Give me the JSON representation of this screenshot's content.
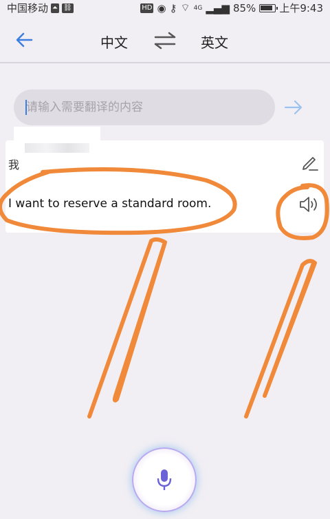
{
  "status_bar": {
    "carrier": "中国移动",
    "hd": "HD",
    "network": "4G",
    "battery": "85%",
    "time": "上午9:43"
  },
  "header": {
    "source_lang": "中文",
    "target_lang": "英文",
    "back_icon": "back-arrow-icon",
    "swap_icon": "swap-icon"
  },
  "input": {
    "placeholder": "请输入需要翻译的内容",
    "value": ""
  },
  "result": {
    "source_text": "我",
    "source_end": "。",
    "translation": "I want to reserve a standard room.",
    "edit_icon": "edit-icon",
    "speaker_icon": "speaker-icon"
  },
  "mic_icon": "microphone-icon",
  "colors": {
    "accent": "#3b7ee0",
    "annotation": "#f08a3a"
  }
}
